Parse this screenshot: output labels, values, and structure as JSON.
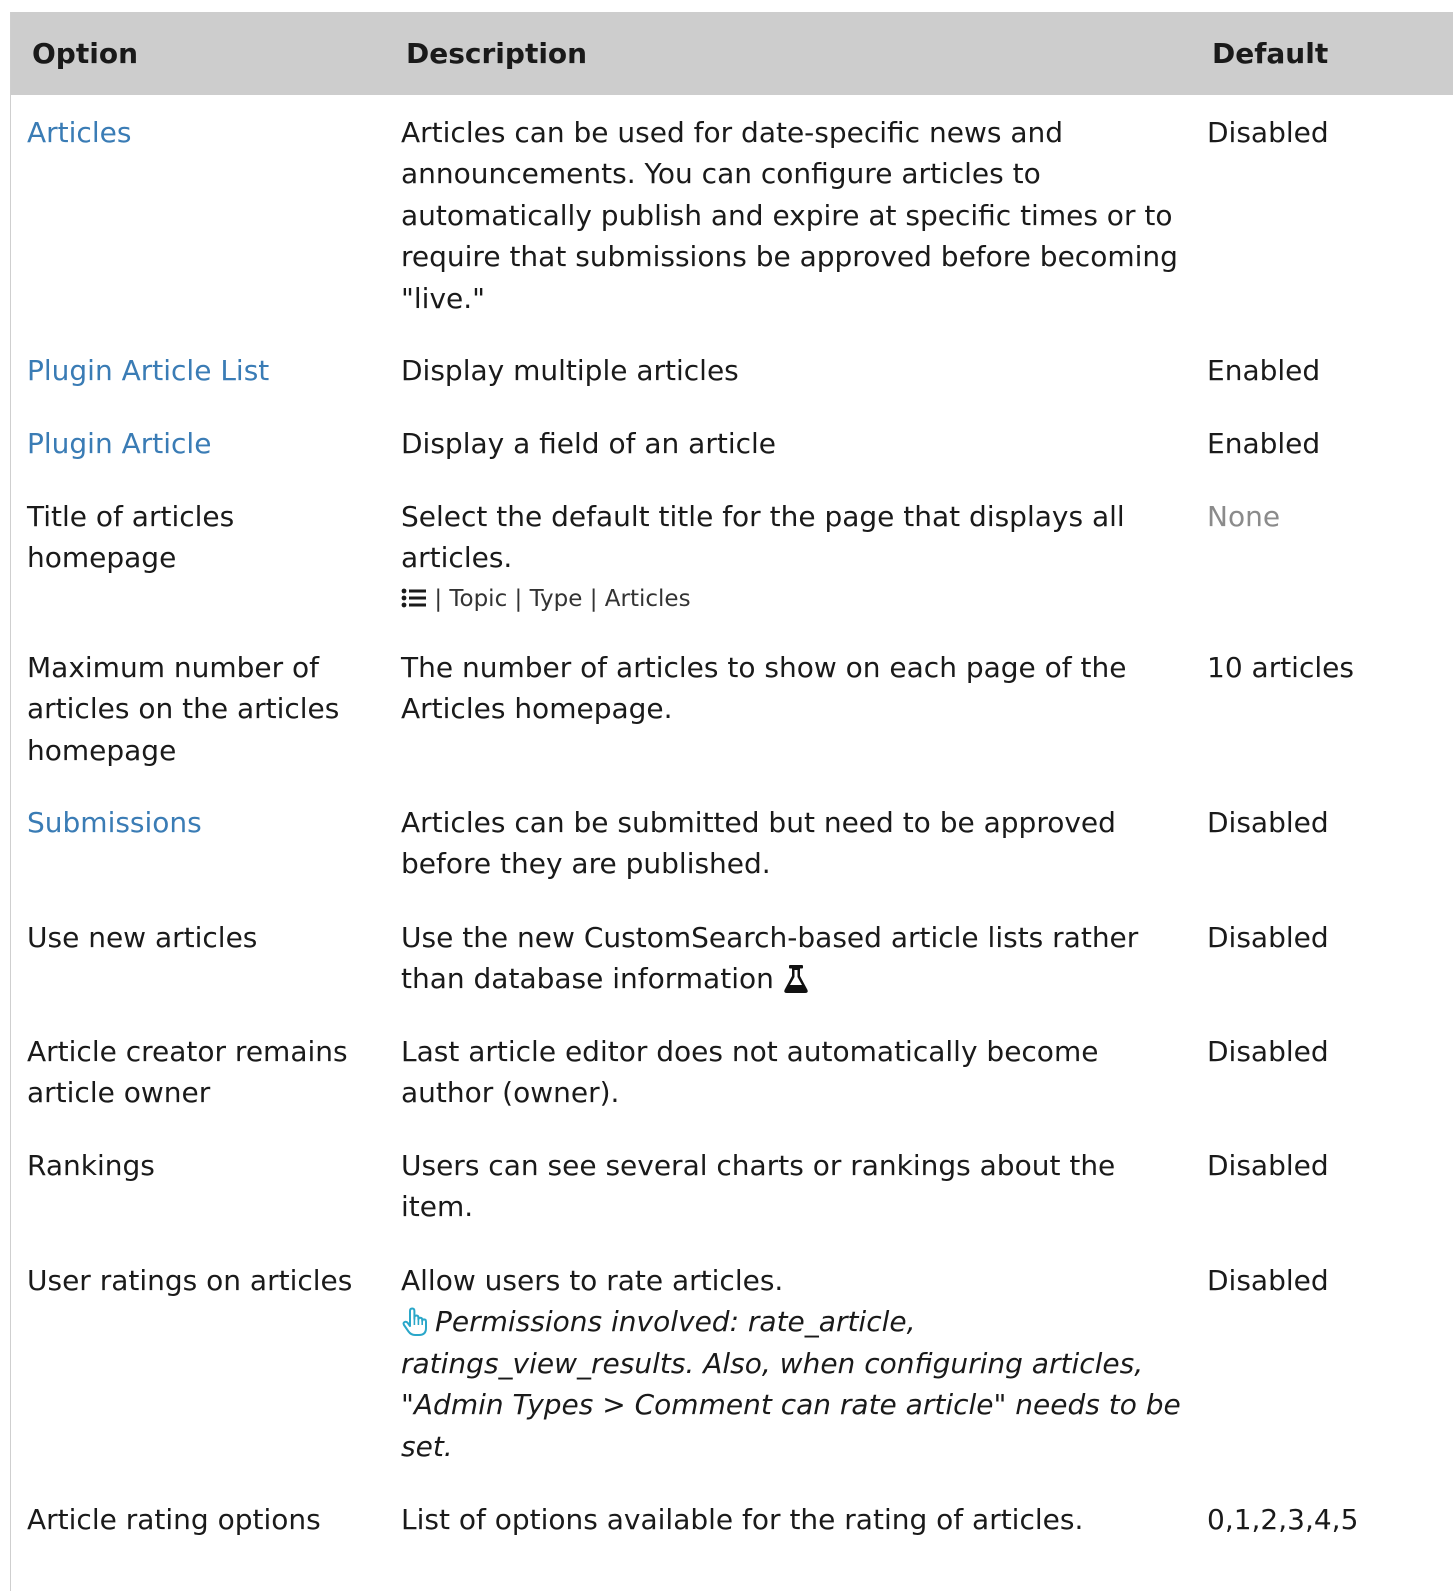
{
  "table": {
    "headers": {
      "option": "Option",
      "description": "Description",
      "default": "Default"
    },
    "rows": [
      {
        "option": "Articles",
        "description": "Articles can be used for date-specific news and announcements. You can configure articles to automatically publish and expire at specific times or to require that submissions be approved before becoming \"live.\"",
        "default": "Disabled"
      },
      {
        "option": "Plugin Article List",
        "description": "Display multiple articles",
        "default": "Enabled"
      },
      {
        "option": "Plugin Article",
        "description": "Display a field of an article",
        "default": "Enabled"
      },
      {
        "option": "Title of articles homepage",
        "description": "Select the default title for the page that displays all articles.",
        "default": "None",
        "sub_options": "| Topic | Type | Articles"
      },
      {
        "option": "Maximum number of articles on the articles homepage",
        "description": "The number of articles to show on each page of the Articles homepage.",
        "default": "10 articles"
      },
      {
        "option": "Submissions",
        "description": "Articles can be submitted but need to be approved before they are published.",
        "default": "Disabled"
      },
      {
        "option": "Use new articles",
        "description": "Use the new CustomSearch-based article lists rather than database information",
        "default": "Disabled"
      },
      {
        "option": "Article creator remains article owner",
        "description": "Last article editor does not automatically become author (owner).",
        "default": "Disabled"
      },
      {
        "option": "Rankings",
        "description": "Users can see several charts or rankings about the item.",
        "default": "Disabled"
      },
      {
        "option": "User ratings on articles",
        "description": "Allow users to rate articles.",
        "default": "Disabled",
        "note_a": "Permissions involved: rate_article, ratings_view_results. Also, when configuring articles, \"",
        "note_b": "Admin Types > Comment can rate article",
        "note_c": "\" needs to be set."
      },
      {
        "option": "Article rating options",
        "description": "List of options available for the rating of articles.",
        "default": "0,1,2,3,4,5"
      }
    ]
  },
  "colors": {
    "header_bg": "#cdcdcd",
    "link": "#3a7cb5",
    "muted": "#8b8b8b"
  },
  "icons": {
    "list": "list-icon",
    "flask": "experimental-flask-icon",
    "permission": "permission-hand-icon"
  }
}
